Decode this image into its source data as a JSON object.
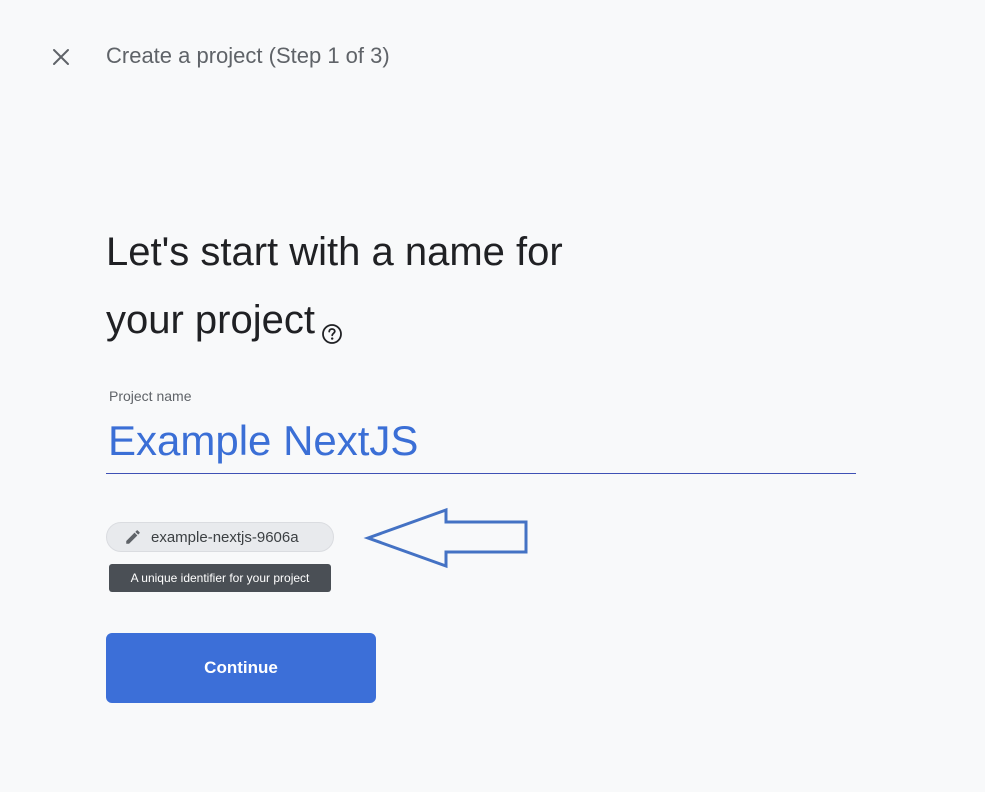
{
  "header": {
    "close_icon": "close-icon",
    "step_title": "Create a project (Step 1 of 3)"
  },
  "main": {
    "heading_line1": "Let's start with a name for",
    "heading_line2": "your project",
    "help_icon": "help-circle-icon"
  },
  "form": {
    "project_name_label": "Project name",
    "project_name_value": "Example NextJS",
    "project_id_icon": "pencil-icon",
    "project_id": "example-nextjs-9606a",
    "project_id_tooltip": "A unique identifier for your project"
  },
  "annotation": {
    "arrow_icon": "left-arrow-outline-icon",
    "color": "#4472c4"
  },
  "actions": {
    "continue_label": "Continue"
  },
  "colors": {
    "accent": "#3c6fd8",
    "input_text": "#3b6fd6",
    "background": "#f8f9fa"
  }
}
